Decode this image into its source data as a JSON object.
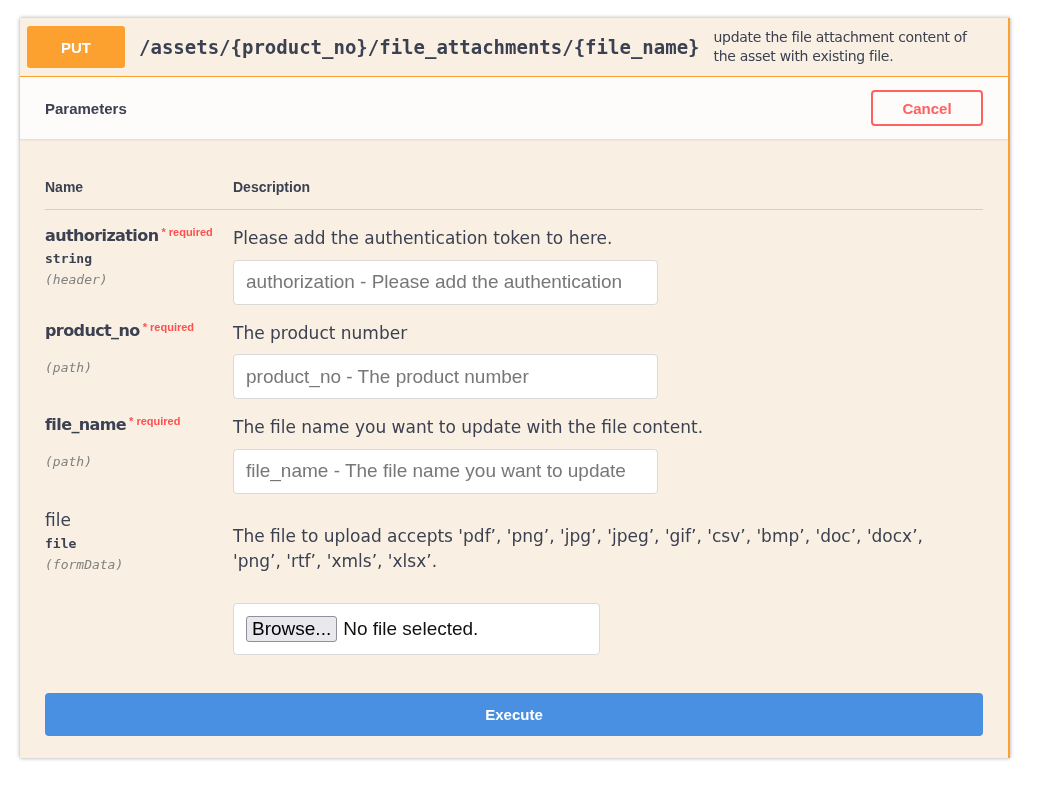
{
  "operation": {
    "method": "PUT",
    "path": "/assets/{product_no}/file_attachments/{file_name}",
    "summary": "update the file attachment content of the asset with existing file."
  },
  "parameters_bar": {
    "title": "Parameters",
    "cancel_label": "Cancel"
  },
  "table": {
    "columns": [
      "Name",
      "Description"
    ],
    "rows": [
      {
        "kind": "text",
        "name": "authorization",
        "required_label": "* required",
        "type": "string",
        "location": "(header)",
        "description": "Please add the authentication token to here.",
        "placeholder": "authorization - Please add the authentication"
      },
      {
        "kind": "text",
        "name": "product_no",
        "required_label": "* required",
        "location": "(path)",
        "description": "The product number",
        "placeholder": "product_no - The product number"
      },
      {
        "kind": "text",
        "name": "file_name",
        "required_label": "* required",
        "location": "(path)",
        "description": "The file name you want to update with the file content.",
        "placeholder": "file_name - The file name you want to update"
      },
      {
        "kind": "file",
        "name": "file",
        "type": "file",
        "location": "(formData)",
        "description": "The file to upload accepts 'pdf’, 'png’, 'jpg’, 'jpeg’, 'gif’, 'csv’, 'bmp’, 'doc’, 'docx’, 'png’, 'rtf’, 'xmls’, 'xlsx’.",
        "browse_label": "Browse...",
        "file_status": "No file selected."
      }
    ]
  },
  "execute_label": "Execute"
}
